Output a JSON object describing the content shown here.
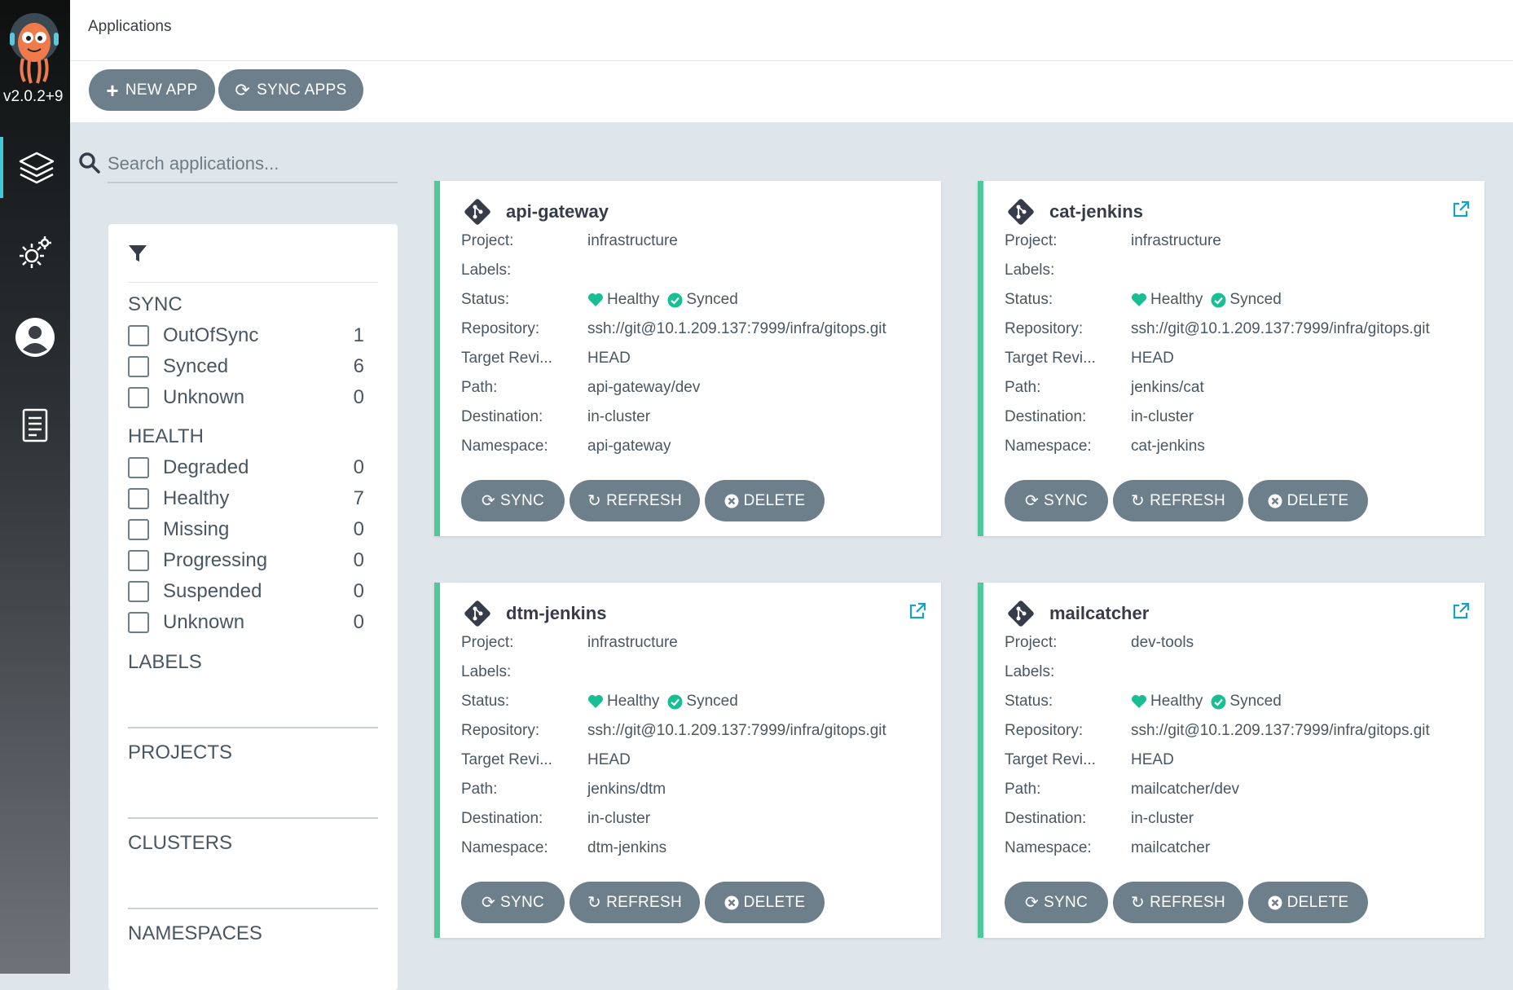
{
  "app": {
    "version": "v2.0.2+9"
  },
  "header": {
    "title": "Applications"
  },
  "toolbar": {
    "new_app_label": "NEW APP",
    "sync_apps_label": "SYNC APPS"
  },
  "search": {
    "placeholder": "Search applications..."
  },
  "filters": {
    "sync_heading": "SYNC",
    "sync": [
      {
        "label": "OutOfSync",
        "count": "1"
      },
      {
        "label": "Synced",
        "count": "6"
      },
      {
        "label": "Unknown",
        "count": "0"
      }
    ],
    "health_heading": "HEALTH",
    "health": [
      {
        "label": "Degraded",
        "count": "0"
      },
      {
        "label": "Healthy",
        "count": "7"
      },
      {
        "label": "Missing",
        "count": "0"
      },
      {
        "label": "Progressing",
        "count": "0"
      },
      {
        "label": "Suspended",
        "count": "0"
      },
      {
        "label": "Unknown",
        "count": "0"
      }
    ],
    "labels_heading": "LABELS",
    "projects_heading": "PROJECTS",
    "clusters_heading": "CLUSTERS",
    "namespaces_heading": "NAMESPACES"
  },
  "field_labels": {
    "project": "Project:",
    "labels": "Labels:",
    "status": "Status:",
    "repository": "Repository:",
    "target": "Target Revi...",
    "path": "Path:",
    "destination": "Destination:",
    "namespace": "Namespace:"
  },
  "buttons": {
    "sync": "SYNC",
    "refresh": "REFRESH",
    "delete": "DELETE"
  },
  "apps": [
    {
      "name": "api-gateway",
      "project": "infrastructure",
      "labels": "",
      "health": "Healthy",
      "sync": "Synced",
      "repository": "ssh://git@10.1.209.137:7999/infra/gitops.git",
      "target": "HEAD",
      "path": "api-gateway/dev",
      "destination": "in-cluster",
      "namespace": "api-gateway"
    },
    {
      "name": "cat-jenkins",
      "project": "infrastructure",
      "labels": "",
      "health": "Healthy",
      "sync": "Synced",
      "repository": "ssh://git@10.1.209.137:7999/infra/gitops.git",
      "target": "HEAD",
      "path": "jenkins/cat",
      "destination": "in-cluster",
      "namespace": "cat-jenkins"
    },
    {
      "name": "dtm-jenkins",
      "project": "infrastructure",
      "labels": "",
      "health": "Healthy",
      "sync": "Synced",
      "repository": "ssh://git@10.1.209.137:7999/infra/gitops.git",
      "target": "HEAD",
      "path": "jenkins/dtm",
      "destination": "in-cluster",
      "namespace": "dtm-jenkins"
    },
    {
      "name": "mailcatcher",
      "project": "dev-tools",
      "labels": "",
      "health": "Healthy",
      "sync": "Synced",
      "repository": "ssh://git@10.1.209.137:7999/infra/gitops.git",
      "target": "HEAD",
      "path": "mailcatcher/dev",
      "destination": "in-cluster",
      "namespace": "mailcatcher"
    }
  ],
  "colors": {
    "healthy": "#18be94",
    "synced": "#18be94",
    "button": "#6d7f8b",
    "accent": "#44c8d8"
  }
}
